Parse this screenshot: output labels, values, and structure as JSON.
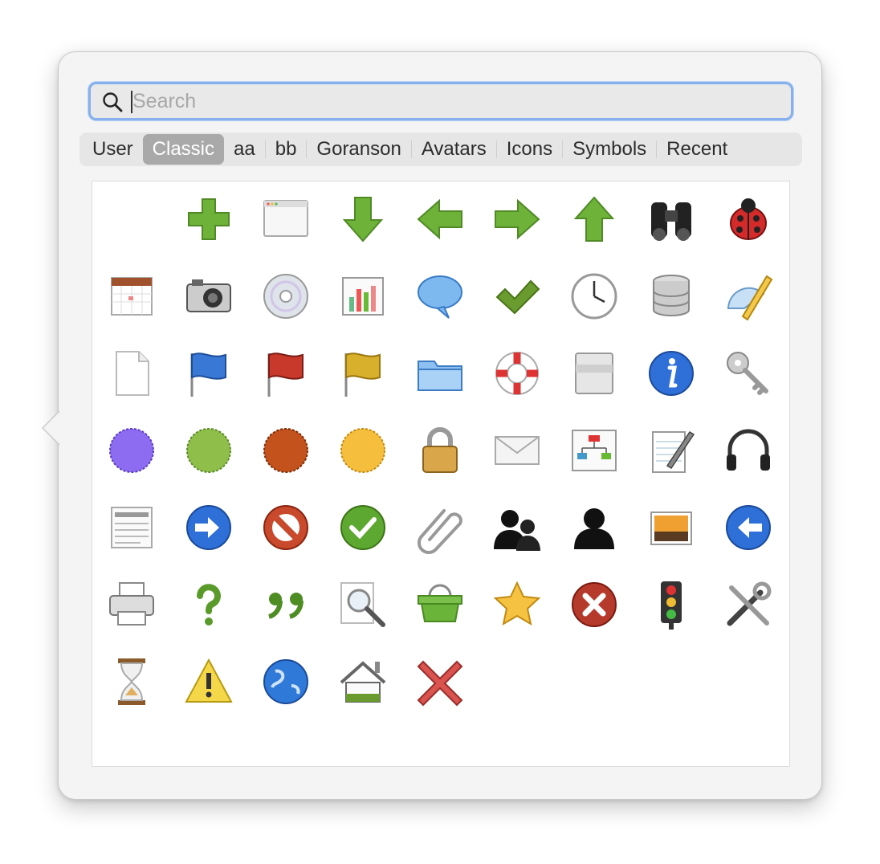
{
  "search": {
    "placeholder": "Search",
    "value": ""
  },
  "tabs": [
    {
      "label": "User",
      "active": false
    },
    {
      "label": "Classic",
      "active": true
    },
    {
      "label": "aa",
      "active": false
    },
    {
      "label": "bb",
      "active": false
    },
    {
      "label": "Goranson",
      "active": false
    },
    {
      "label": "Avatars",
      "active": false
    },
    {
      "label": "Icons",
      "active": false
    },
    {
      "label": "Symbols",
      "active": false
    },
    {
      "label": "Recent",
      "active": false
    }
  ],
  "icons": [
    "blank-icon",
    "plus-icon",
    "window-icon",
    "arrow-down-icon",
    "arrow-left-icon",
    "arrow-right-icon",
    "arrow-up-icon",
    "binoculars-icon",
    "ladybug-icon",
    "calendar-icon",
    "camera-icon",
    "cd-icon",
    "bar-chart-icon",
    "speech-bubble-icon",
    "checkmark-icon",
    "clock-icon",
    "database-icon",
    "protractor-pencil-icon",
    "document-icon",
    "blue-flag-icon",
    "red-flag-icon",
    "yellow-flag-icon",
    "folder-icon",
    "lifebuoy-icon",
    "storage-box-icon",
    "info-icon",
    "key-icon",
    "purple-badge-icon",
    "green-badge-icon",
    "red-badge-icon",
    "yellow-badge-icon",
    "lock-icon",
    "envelope-icon",
    "org-chart-icon",
    "notepad-pencil-icon",
    "headphones-icon",
    "newspaper-icon",
    "blue-arrow-right-circle-icon",
    "no-entry-icon",
    "green-check-circle-icon",
    "paperclip-icon",
    "two-users-icon",
    "user-icon",
    "landscape-picture-icon",
    "blue-arrow-left-circle-icon",
    "printer-icon",
    "question-mark-icon",
    "quote-marks-icon",
    "magnifier-icon",
    "basket-icon",
    "star-icon",
    "red-x-circle-icon",
    "traffic-light-icon",
    "tools-icon",
    "hourglass-icon",
    "warning-icon",
    "globe-icon",
    "house-icon",
    "red-x-icon"
  ]
}
